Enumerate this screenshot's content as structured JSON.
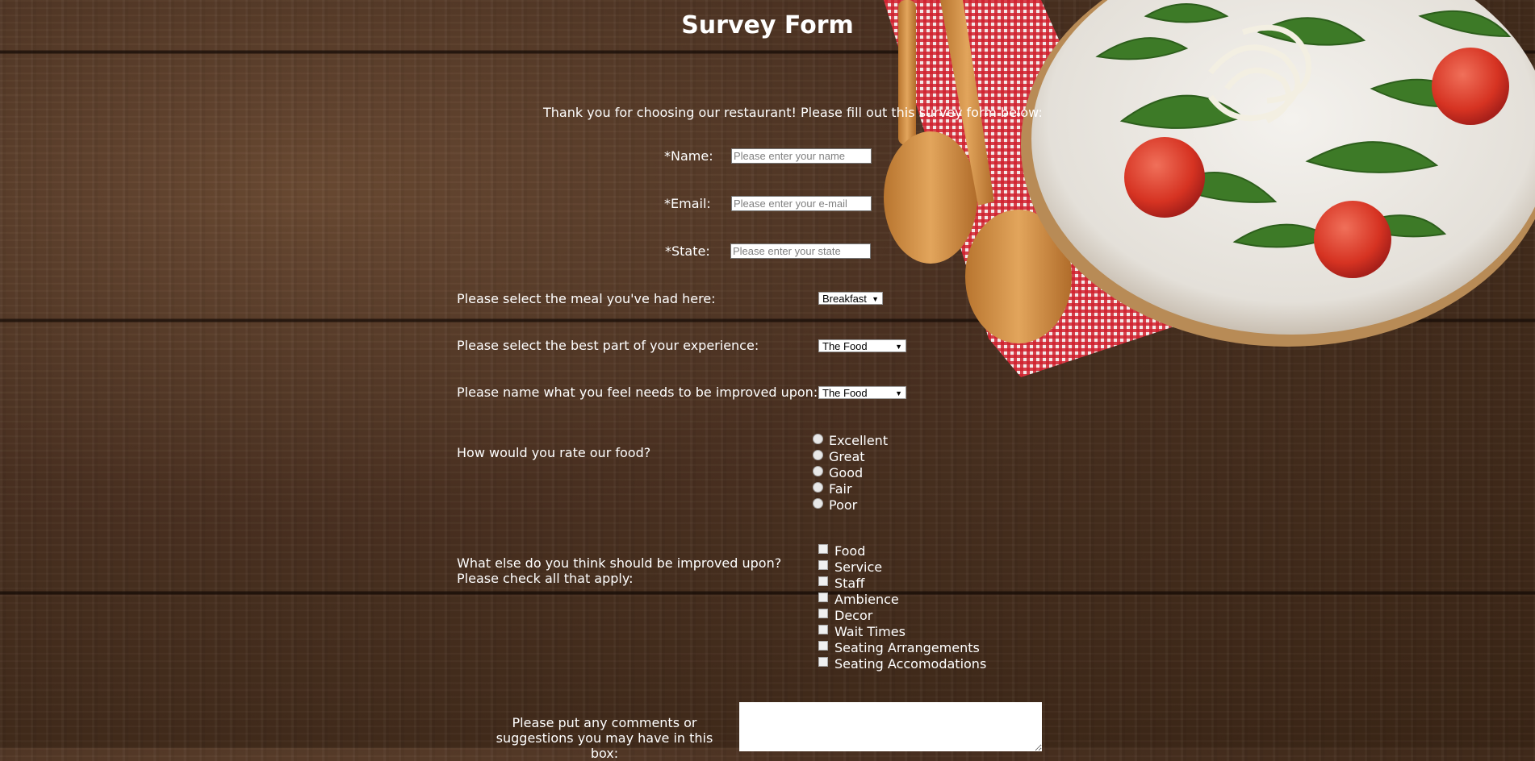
{
  "title": "Survey Form",
  "intro": "Thank you for choosing our restaurant! Please fill out this survey form below:",
  "fields": {
    "name": {
      "label": "*Name:",
      "placeholder": "Please enter your name"
    },
    "email": {
      "label": "*Email:",
      "placeholder": "Please enter your e-mail"
    },
    "state": {
      "label": "*State:",
      "placeholder": "Please enter your state"
    }
  },
  "meal": {
    "label": "Please select the meal you've had here:",
    "value": "Breakfast"
  },
  "best_part": {
    "label": "Please select the best part of your experience:",
    "value": "The Food"
  },
  "improve_select": {
    "label": "Please name what you feel needs to be improved upon:",
    "value": "The Food"
  },
  "rating": {
    "label": "How would you rate our food?",
    "options": [
      "Excellent",
      "Great",
      "Good",
      "Fair",
      "Poor"
    ]
  },
  "improve_check": {
    "label": "What else do you think should be improved upon? Please check all that apply:",
    "options": [
      "Food",
      "Service",
      "Staff",
      "Ambience",
      "Decor",
      "Wait Times",
      "Seating Arrangements",
      "Seating Accomodations"
    ]
  },
  "comments": {
    "label": "Please put any comments or suggestions you may have in this box:"
  },
  "icons": {
    "select_arrow": "dropdown-arrow-icon"
  },
  "colors": {
    "text": "#ffffff",
    "wood": "#4a3121",
    "napkin": "#c8202a",
    "tomato": "#d93a2b",
    "greens": "#3f7a2a"
  }
}
